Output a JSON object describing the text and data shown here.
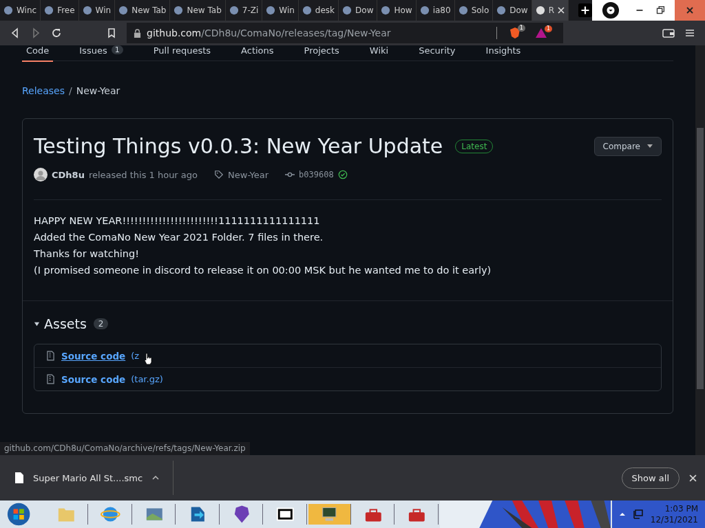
{
  "browser": {
    "tabs": [
      {
        "label": "Winc",
        "selected": false
      },
      {
        "label": "Free",
        "selected": false
      },
      {
        "label": "Win",
        "selected": false
      },
      {
        "label": "New Tab",
        "selected": false
      },
      {
        "label": "New Tab",
        "selected": false
      },
      {
        "label": "7-Zi",
        "selected": false
      },
      {
        "label": "Win",
        "selected": false
      },
      {
        "label": "desk",
        "selected": false
      },
      {
        "label": "Dow",
        "selected": false
      },
      {
        "label": "How",
        "selected": false
      },
      {
        "label": "ia80",
        "selected": false
      },
      {
        "label": "Solo",
        "selected": false
      },
      {
        "label": "Dow",
        "selected": false
      },
      {
        "label": "R",
        "selected": true
      }
    ],
    "address": {
      "host": "github.com",
      "path": "/CDh8u/ComaNo/releases/tag/New-Year"
    },
    "shield_count": "1",
    "rewards_count": "1"
  },
  "repo_nav": [
    {
      "label": "Code",
      "selected": true
    },
    {
      "label": "Issues",
      "count": "1",
      "selected": false
    },
    {
      "label": "Pull requests",
      "selected": false
    },
    {
      "label": "Actions",
      "selected": false
    },
    {
      "label": "Projects",
      "selected": false
    },
    {
      "label": "Wiki",
      "selected": false
    },
    {
      "label": "Security",
      "selected": false
    },
    {
      "label": "Insights",
      "selected": false
    }
  ],
  "breadcrumb": {
    "link": "Releases",
    "separator": "/",
    "current": "New-Year"
  },
  "release": {
    "title": "Testing Things v0.0.3: New Year Update",
    "badge": "Latest",
    "compare": "Compare",
    "author": "CDh8u",
    "released": "released this 1 hour ago",
    "tag": "New-Year",
    "commit": "b039608",
    "verified": true,
    "body": [
      "HAPPY NEW YEAR!!!!!!!!!!!!!!!!!!!!!!!!1111111111111111",
      "Added the ComaNo New Year 2021 Folder. 7 files in there.",
      "Thanks for watching!",
      "(I promised someone in discord to release it on 00:00 MSK but he wanted me to do it early)"
    ],
    "assets": {
      "title": "Assets",
      "count": "2",
      "expanded": true,
      "items": [
        {
          "name": "Source code",
          "format": "(z",
          "hovered": true
        },
        {
          "name": "Source code",
          "format": "(tar.gz)",
          "hovered": false
        }
      ]
    }
  },
  "status_url": "github.com/CDh8u/ComaNo/archive/refs/tags/New-Year.zip",
  "download_bar": {
    "file": "Super Mario All St....smc",
    "show_all": "Show all"
  },
  "taskbar": {
    "time": "1:03 PM",
    "date": "12/31/2021"
  }
}
